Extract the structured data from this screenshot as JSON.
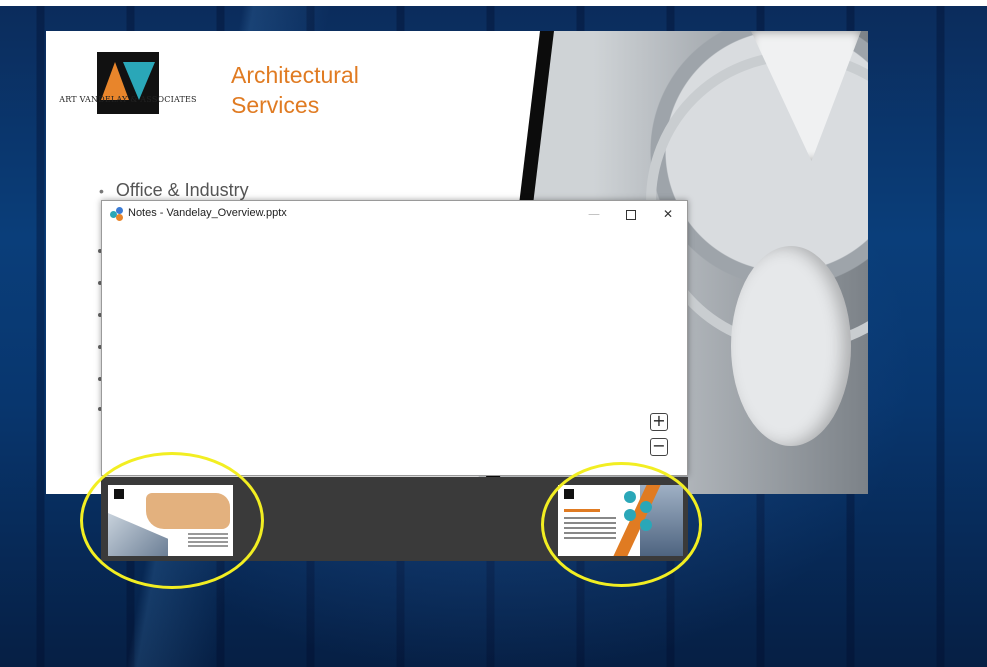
{
  "slide": {
    "logo_text": "ART VANDELAY & ASSOCIATES",
    "title_line1": "Architectural",
    "title_line2": "Services",
    "bullet_1": "Office & Industry",
    "bullet_marker": "•"
  },
  "notes_window": {
    "title": "Notes - Vandelay_Overview.pptx",
    "minimize_label": "—",
    "close_label": "✕",
    "zoom_in_label": "+",
    "zoom_out_label": "−"
  },
  "filmstrip": {
    "thumbnails": [
      {
        "description": "previous slide"
      },
      {
        "description": "next slide"
      }
    ]
  },
  "colors": {
    "accent_orange": "#e07b22",
    "accent_teal": "#2aa7b8",
    "annotation_yellow": "#f2ee22",
    "filmstrip_bg": "#3a3a3a"
  }
}
